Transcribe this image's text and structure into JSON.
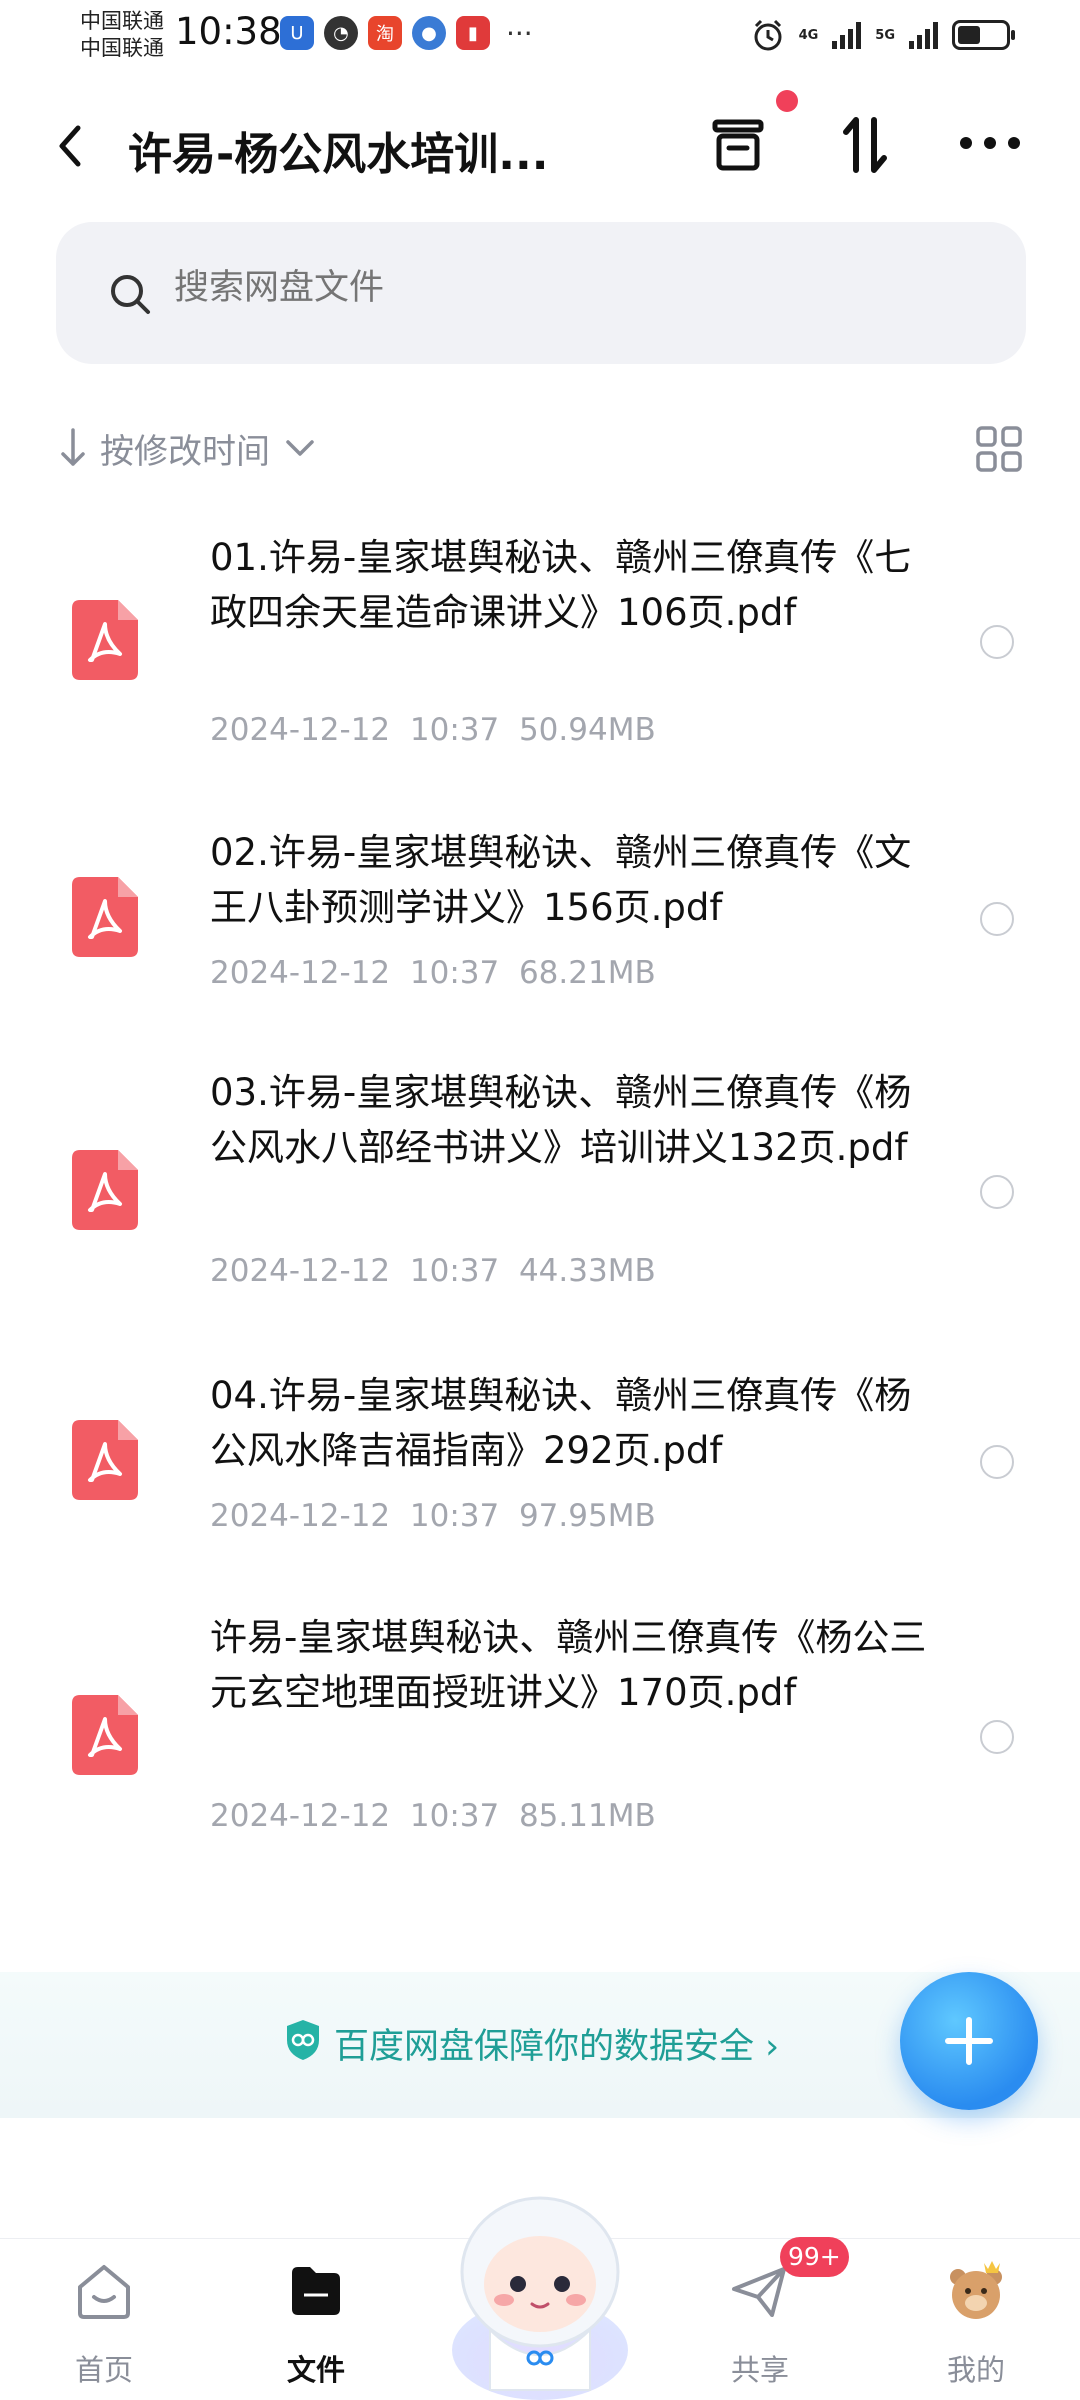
{
  "status_bar": {
    "carrier_1": "中国联通",
    "carrier_2": "中国联通",
    "time": "10:38",
    "network_1": "4G",
    "network_2": "5G"
  },
  "header": {
    "title": "许易-杨公风水培训..."
  },
  "search": {
    "placeholder": "搜索网盘文件"
  },
  "sort": {
    "label": "按修改时间"
  },
  "files": [
    {
      "name": "01.许易-皇家堪舆秘诀、赣州三僚真传《七政四余天星造命课讲义》106页.pdf",
      "date": "2024-12-12",
      "time": "10:37",
      "size": "50.94MB"
    },
    {
      "name": "02.许易-皇家堪舆秘诀、赣州三僚真传《文王八卦预测学讲义》156页.pdf",
      "date": "2024-12-12",
      "time": "10:37",
      "size": "68.21MB"
    },
    {
      "name": "03.许易-皇家堪舆秘诀、赣州三僚真传《杨公风水八部经书讲义》培训讲义132页.pdf",
      "date": "2024-12-12",
      "time": "10:37",
      "size": "44.33MB"
    },
    {
      "name": "04.许易-皇家堪舆秘诀、赣州三僚真传《杨公风水降吉福指南》292页.pdf",
      "date": "2024-12-12",
      "time": "10:37",
      "size": "97.95MB"
    },
    {
      "name": "许易-皇家堪舆秘诀、赣州三僚真传《杨公三元玄空地理面授班讲义》170页.pdf",
      "date": "2024-12-12",
      "time": "10:37",
      "size": "85.11MB"
    }
  ],
  "banner": {
    "text": "百度网盘保障你的数据安全 ›"
  },
  "tabs": [
    {
      "label": "首页"
    },
    {
      "label": "文件"
    },
    {
      "label": "共享"
    },
    {
      "label": "我的"
    }
  ],
  "share_badge": "99+",
  "colors": {
    "accent_blue": "#2a8cf0",
    "pdf_red": "#f25c64",
    "badge_red": "#f0405a",
    "banner_teal": "#1f9e96"
  }
}
